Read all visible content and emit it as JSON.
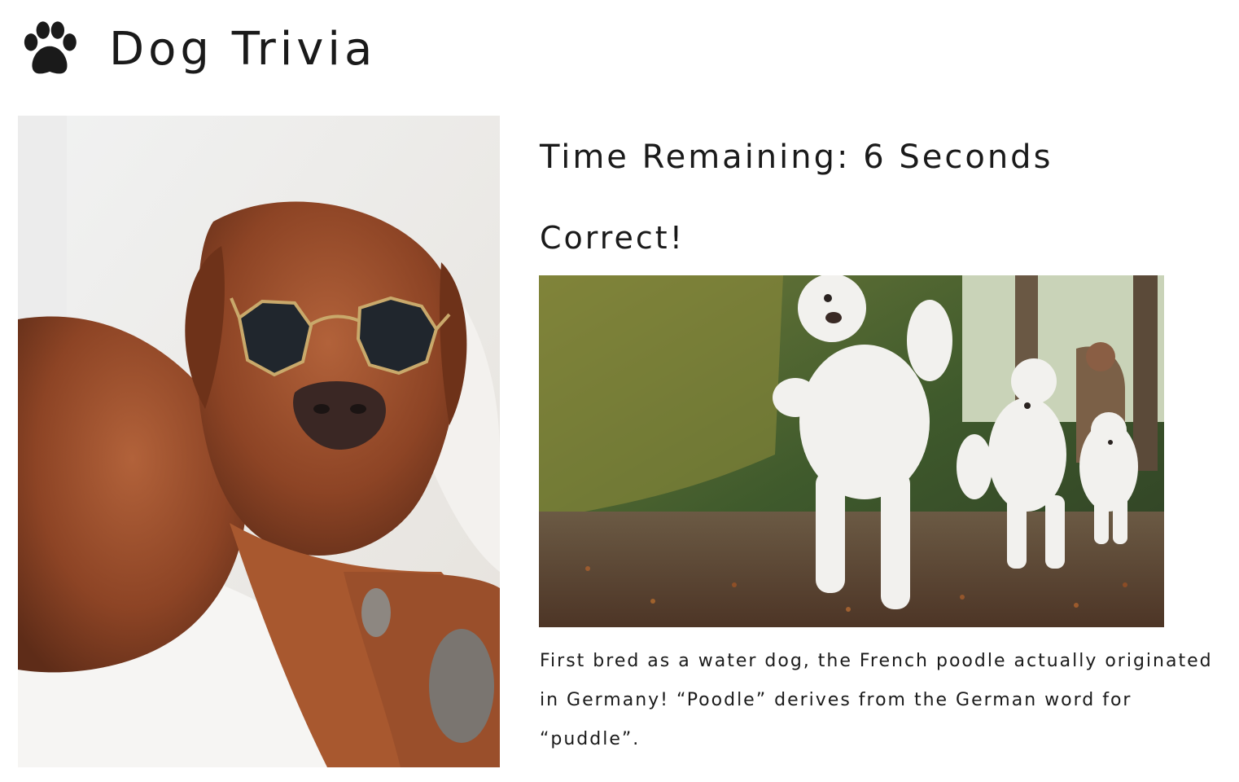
{
  "header": {
    "icon": "paw-icon",
    "title": "Dog Trivia"
  },
  "question_image": {
    "description_icon": "dog-photo"
  },
  "status": {
    "timer_text": "Time Remaining: 6 Seconds",
    "result_text": "Correct!"
  },
  "answer": {
    "fact_text": "First bred as a water dog, the French poodle actually originated in Germany! “Poodle” derives from the German word for “puddle”."
  },
  "colors": {
    "text": "#1a1a1a",
    "background": "#ffffff"
  }
}
